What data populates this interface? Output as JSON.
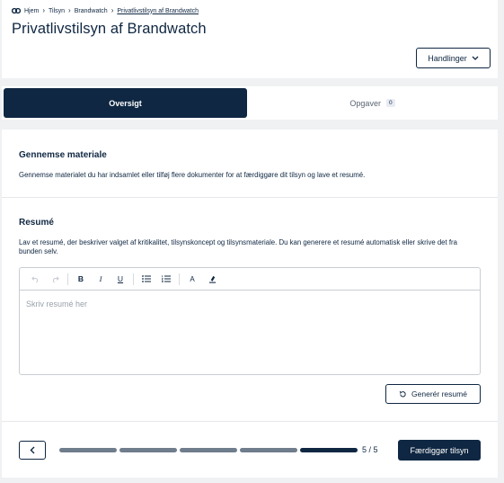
{
  "breadcrumb": {
    "items": [
      "Hjem",
      "Tilsyn",
      "Brandwatch",
      "Privatlivstilsyn af Brandwatch"
    ]
  },
  "header": {
    "title": "Privatlivstilsyn af Brandwatch",
    "actions_label": "Handlinger"
  },
  "tabs": [
    {
      "label": "Oversigt",
      "active": true
    },
    {
      "label": "Opgaver",
      "badge": "0",
      "active": false
    }
  ],
  "review": {
    "title": "Gennemse materiale",
    "text": "Gennemse materialet du har indsamlet eller tilføj flere dokumenter for at færdiggøre dit tilsyn og lave et resumé."
  },
  "summary": {
    "title": "Resumé",
    "text": "Lav et resumé, der beskriver valget af kritikalitet, tilsynskoncept og tilsynsmateriale. Du kan generere et resumé automatisk eller skrive det fra bunden selv.",
    "placeholder": "Skriv resumé her",
    "generate_label": "Generér resumé"
  },
  "toolbar": {
    "bold": "B",
    "italic": "I",
    "underline": "U",
    "font_color": "A"
  },
  "footer": {
    "step_count": "5 / 5",
    "current_step": 5,
    "total_steps": 5,
    "finish_label": "Færdiggør tilsyn"
  },
  "colors": {
    "primary": "#0f2742",
    "progress_inactive": "#6f7d8c",
    "background": "#f0f1f3"
  }
}
